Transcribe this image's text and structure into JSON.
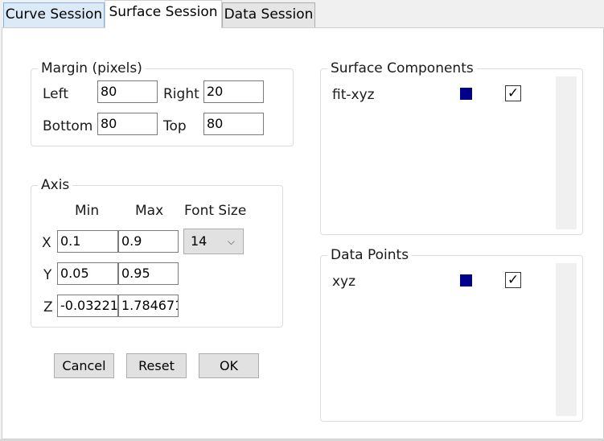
{
  "tabs": [
    "Curve Session",
    "Surface Session",
    "Data Session"
  ],
  "margin": {
    "legend": "Margin (pixels)",
    "left_label": "Left",
    "left_value": "80",
    "right_label": "Right",
    "right_value": "20",
    "bottom_label": "Bottom",
    "bottom_value": "80",
    "top_label": "Top",
    "top_value": "80"
  },
  "axis": {
    "legend": "Axis",
    "col_min": "Min",
    "col_max": "Max",
    "col_font": "Font Size",
    "x_label": "X",
    "x_min": "0.1",
    "x_max": "0.9",
    "y_label": "Y",
    "y_min": "0.05",
    "y_max": "0.95",
    "z_label": "Z",
    "z_min": "-0.03221",
    "z_max": "1.784671",
    "font_size": "14"
  },
  "buttons": {
    "cancel": "Cancel",
    "reset": "Reset",
    "ok": "OK"
  },
  "surface_components": {
    "legend": "Surface Components",
    "item_label": "fit-xyz",
    "item_color": "#00008b",
    "checked_glyph": "✓"
  },
  "data_points": {
    "legend": "Data Points",
    "item_label": "xyz",
    "item_color": "#00008b",
    "checked_glyph": "✓"
  },
  "icons": {
    "dropdown": "chevron-down-icon",
    "check": "checkmark-icon"
  }
}
